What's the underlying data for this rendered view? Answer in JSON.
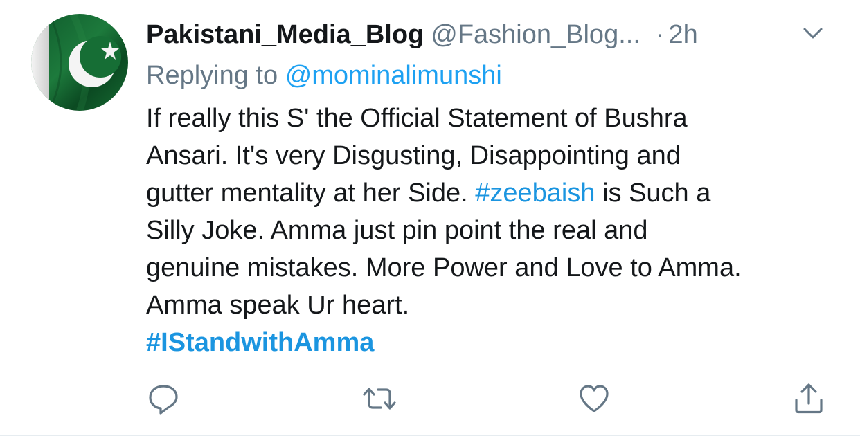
{
  "tweet": {
    "display_name": "Pakistani_Media_Blog",
    "handle": "@Fashion_Blog...",
    "separator": "·",
    "time": "2h",
    "reply_prefix": "Replying to",
    "reply_to": "@mominalimunshi",
    "body": {
      "line1": "If really this S' the Official Statement of Bushra",
      "line2": "Ansari. It's very Disgusting, Disappointing and",
      "line3_pre": "gutter mentality at her Side.",
      "line3_tag": "#zeebaish",
      "line3_post": "is Such a",
      "line4": "Silly Joke. Amma just pin point the real and",
      "line5": "genuine mistakes. More Power and Love to Amma.",
      "line6": "Amma speak Ur heart.",
      "line7_tag": "#IStandwithAmma"
    }
  },
  "icons": {
    "avatar": "pakistan-flag-avatar",
    "menu": "chevron-down-icon",
    "reply": "reply-icon",
    "retweet": "retweet-icon",
    "like": "heart-icon",
    "share": "share-icon"
  },
  "colors": {
    "text": "#14171a",
    "secondary": "#657786",
    "link": "#1da1f2",
    "hashtag": "#1b95e0",
    "flag_green": "#01411c"
  }
}
